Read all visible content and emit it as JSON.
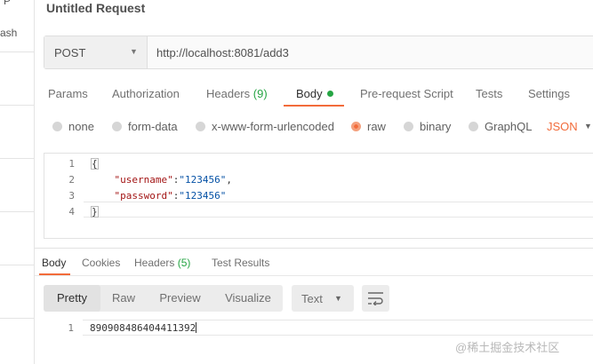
{
  "sidebar": {
    "frag_top": "P",
    "frag_mid": "ash"
  },
  "request": {
    "title": "Untitled Request",
    "method": "POST",
    "url": "http://localhost:8081/add3"
  },
  "tabs": {
    "params": "Params",
    "authorization": "Authorization",
    "headers": "Headers",
    "headers_count": "(9)",
    "body": "Body",
    "prerequest": "Pre-request Script",
    "tests": "Tests",
    "settings": "Settings"
  },
  "body_options": {
    "none": "none",
    "form_data": "form-data",
    "urlencoded": "x-www-form-urlencoded",
    "raw": "raw",
    "binary": "binary",
    "graphql": "GraphQL",
    "selected": "raw",
    "format": "JSON"
  },
  "editor": {
    "line_numbers": [
      "1",
      "2",
      "3",
      "4"
    ],
    "line1": "{",
    "username_key": "\"username\"",
    "username_value": "\"123456\"",
    "password_key": "\"password\"",
    "password_value": "\"123456\"",
    "line4": "}"
  },
  "response_tabs": {
    "body": "Body",
    "cookies": "Cookies",
    "headers": "Headers",
    "headers_count": "(5)",
    "test_results": "Test Results"
  },
  "response_view": {
    "pretty": "Pretty",
    "raw": "Raw",
    "preview": "Preview",
    "visualize": "Visualize",
    "format": "Text"
  },
  "response_body": {
    "line_number": "1",
    "value": "890908486404411392"
  },
  "watermark": "@稀土掘金技术社区",
  "colors": {
    "accent": "#f26b3a",
    "count_green": "#26a544"
  }
}
